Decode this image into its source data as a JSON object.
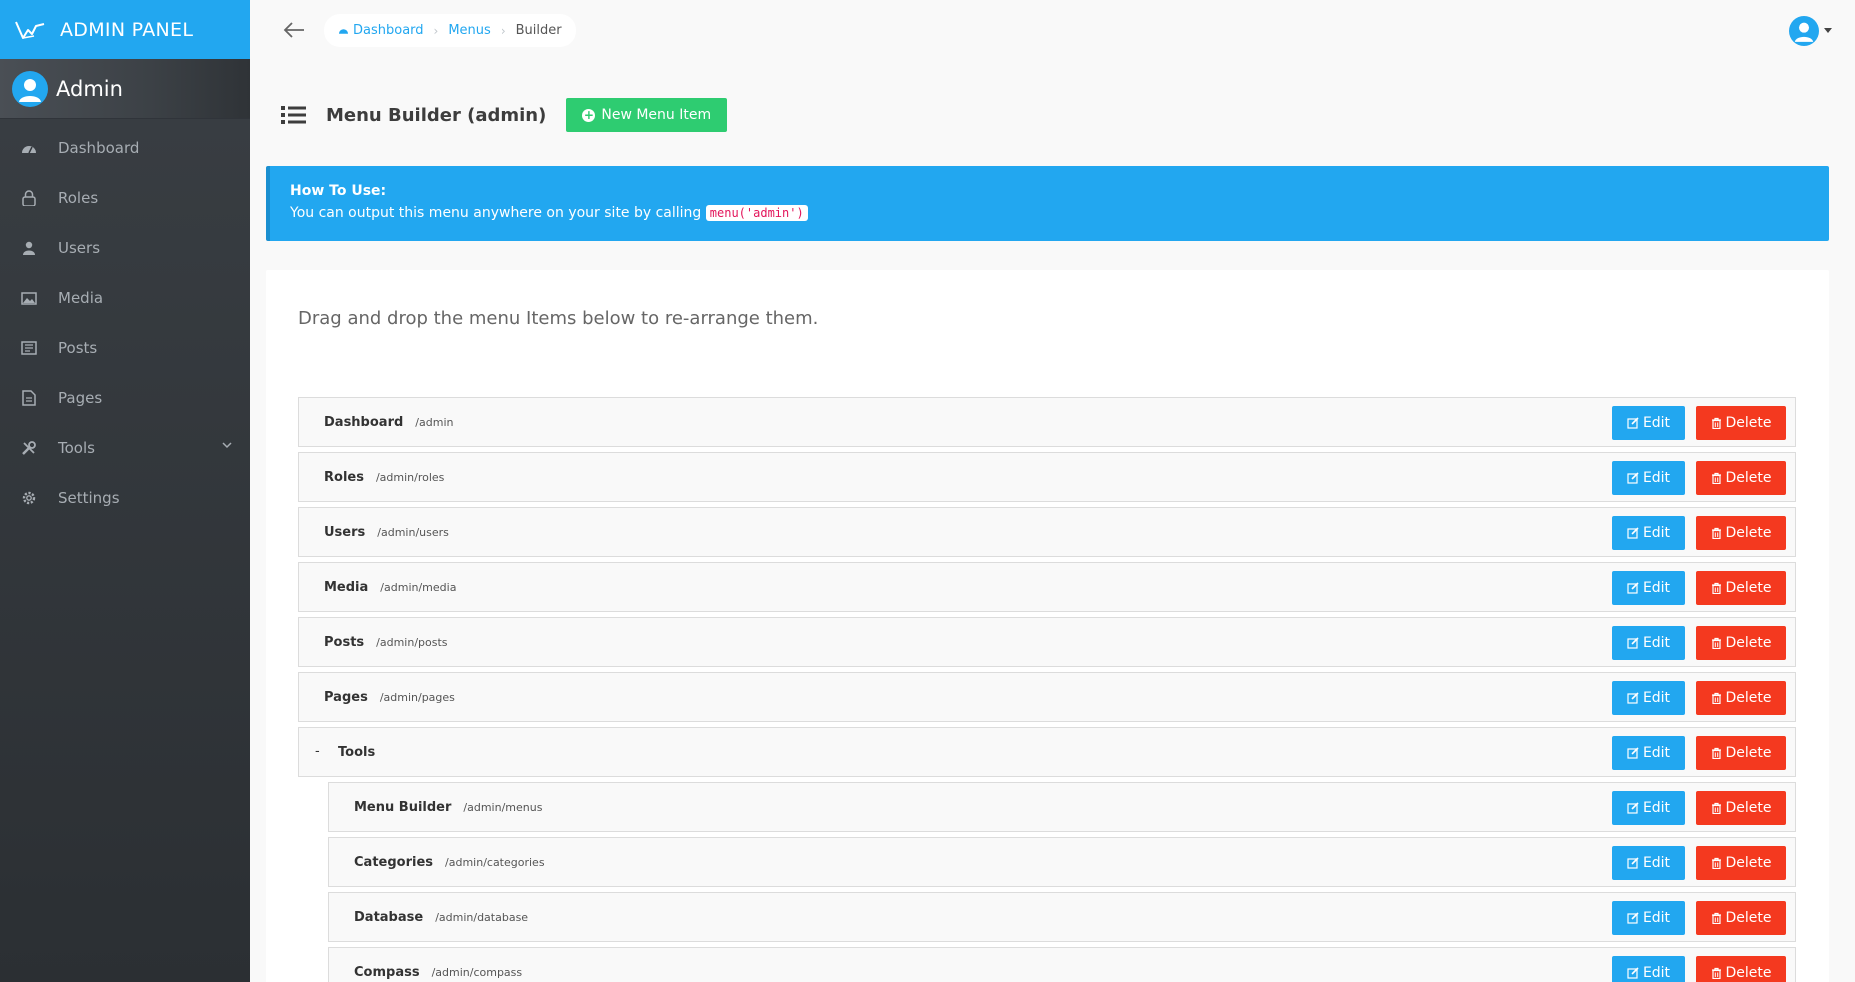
{
  "brand": {
    "title": "ADMIN PANEL"
  },
  "profile": {
    "name": "Admin"
  },
  "sidebar": {
    "items": [
      {
        "label": "Dashboard",
        "icon": "dashboard-icon"
      },
      {
        "label": "Roles",
        "icon": "lock-icon"
      },
      {
        "label": "Users",
        "icon": "person-icon"
      },
      {
        "label": "Media",
        "icon": "image-icon"
      },
      {
        "label": "Posts",
        "icon": "news-icon"
      },
      {
        "label": "Pages",
        "icon": "file-text-icon"
      },
      {
        "label": "Tools",
        "icon": "tools-icon",
        "has_children": true
      },
      {
        "label": "Settings",
        "icon": "gear-icon"
      }
    ]
  },
  "breadcrumb": {
    "items": [
      "Dashboard",
      "Menus",
      "Builder"
    ]
  },
  "header": {
    "title": "Menu Builder (admin)",
    "new_button": "New Menu Item"
  },
  "alert": {
    "title": "How To Use:",
    "text": "You can output this menu anywhere on your site by calling",
    "code": "menu('admin')"
  },
  "panel": {
    "lead": "Drag and drop the menu Items below to re-arrange them."
  },
  "actions": {
    "edit": "Edit",
    "delete": "Delete"
  },
  "menu_items": [
    {
      "title": "Dashboard",
      "url": "/admin"
    },
    {
      "title": "Roles",
      "url": "/admin/roles"
    },
    {
      "title": "Users",
      "url": "/admin/users"
    },
    {
      "title": "Media",
      "url": "/admin/media"
    },
    {
      "title": "Posts",
      "url": "/admin/posts"
    },
    {
      "title": "Pages",
      "url": "/admin/pages"
    },
    {
      "title": "Tools",
      "url": "",
      "toggle": "-"
    },
    {
      "title": "Menu Builder",
      "url": "/admin/menus"
    },
    {
      "title": "Categories",
      "url": "/admin/categories"
    },
    {
      "title": "Database",
      "url": "/admin/database"
    },
    {
      "title": "Compass",
      "url": "/admin/compass"
    }
  ],
  "colors": {
    "primary": "#22a7f0",
    "success": "#2ecc71",
    "danger": "#f4391f",
    "sidebar": "#33383d"
  }
}
